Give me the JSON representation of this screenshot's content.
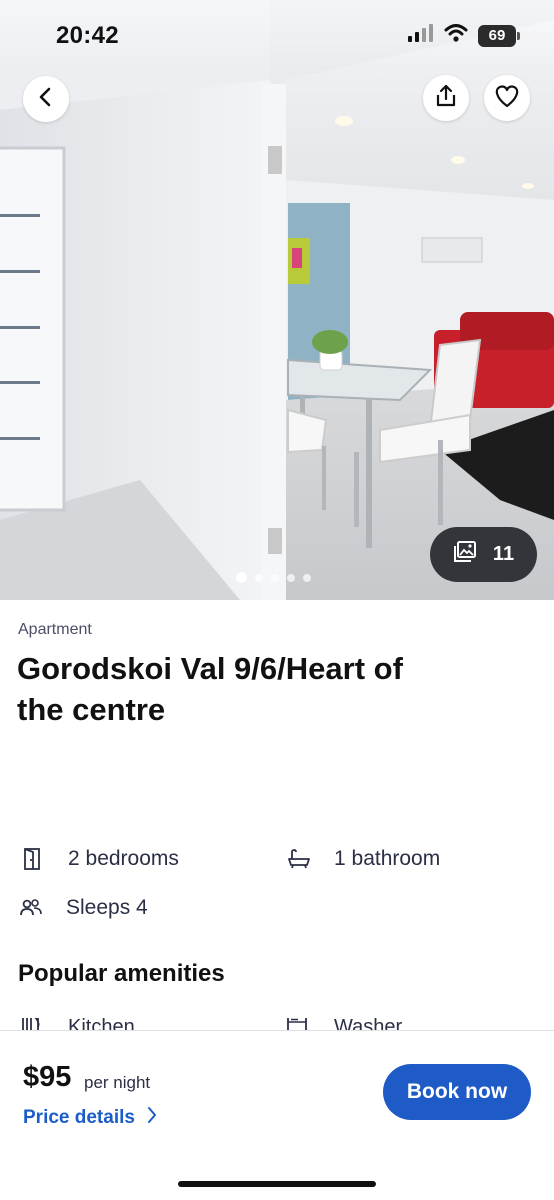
{
  "status_bar": {
    "time": "20:42",
    "battery": "69"
  },
  "listing": {
    "type": "Apartment",
    "title": "Gorodskoi Val 9/6/Heart of the centre",
    "photo_count": "11",
    "carousel": {
      "total_dots": 5,
      "active_index": 0
    }
  },
  "facts": {
    "bedrooms": "2 bedrooms",
    "bathrooms": "1 bathroom",
    "sleeps": "Sleeps 4"
  },
  "amenities": {
    "heading": "Popular amenities",
    "items": [
      "Kitchen",
      "Washer"
    ]
  },
  "booking": {
    "price": "$95",
    "per_night": "per night",
    "price_details": "Price details",
    "book_now": "Book now"
  },
  "colors": {
    "accent": "#1f5bc6",
    "link": "#1b5cc8",
    "sofa": "#c8202a"
  },
  "icons": {
    "back": "chevron-left-icon",
    "share": "share-icon",
    "favorite": "heart-icon",
    "gallery": "gallery-icon",
    "door": "door-icon",
    "bath": "bathtub-icon",
    "people": "people-icon",
    "kitchen": "utensils-icon",
    "washer": "washer-icon"
  }
}
